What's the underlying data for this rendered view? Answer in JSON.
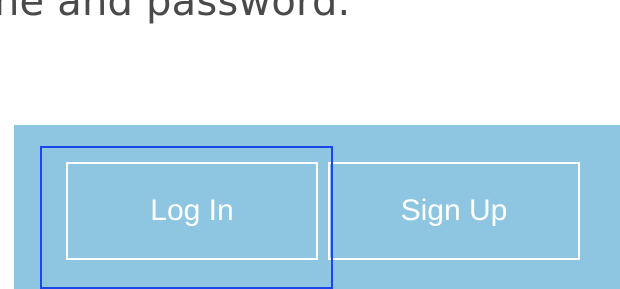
{
  "instruction": {
    "text": "ne and password."
  },
  "auth": {
    "login_label": "Log In",
    "signup_label": "Sign Up"
  },
  "colors": {
    "panel_background": "#8ec6e2",
    "button_border": "#ffffff",
    "focus_outline": "#1a47e8",
    "text": "#4a4a4a"
  }
}
